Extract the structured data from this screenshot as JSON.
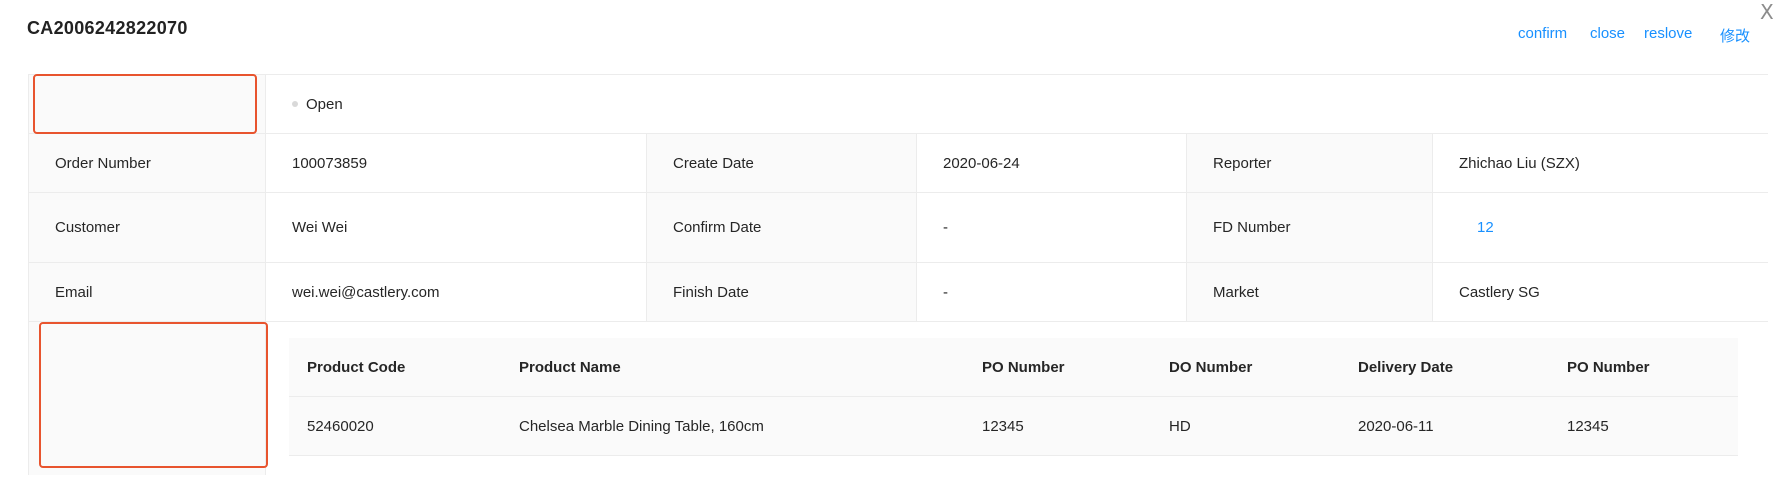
{
  "header": {
    "title": "CA2006242822070",
    "close_symbol": "X",
    "actions": {
      "confirm": "confirm",
      "close": "close",
      "reslove": "reslove",
      "edit": "修改"
    }
  },
  "status": {
    "label": "",
    "value": "Open",
    "dot_color": "#d9d9d9"
  },
  "details": {
    "order_number_label": "Order Number",
    "order_number": "100073859",
    "create_date_label": "Create Date",
    "create_date": "2020-06-24",
    "reporter_label": "Reporter",
    "reporter": "Zhichao Liu (SZX)",
    "customer_label": "Customer",
    "customer": "Wei Wei",
    "confirm_date_label": "Confirm Date",
    "confirm_date": "-",
    "fd_number_label": "FD Number",
    "fd_number": "12",
    "email_label": "Email",
    "email": "wei.wei@castlery.com",
    "finish_date_label": "Finish Date",
    "finish_date": "-",
    "market_label": "Market",
    "market": "Castlery SG"
  },
  "products": {
    "label": "",
    "columns": [
      "Product Code",
      "Product Name",
      "PO Number",
      "DO Number",
      "Delivery Date",
      "PO Number"
    ],
    "rows": [
      [
        "52460020",
        "Chelsea Marble Dining Table, 160cm",
        "12345",
        "HD",
        "2020-06-11",
        "12345"
      ]
    ]
  },
  "colors": {
    "link": "#1890ff",
    "highlight": "#e8542e",
    "label_bg": "#fafafa",
    "border": "#ececec"
  }
}
